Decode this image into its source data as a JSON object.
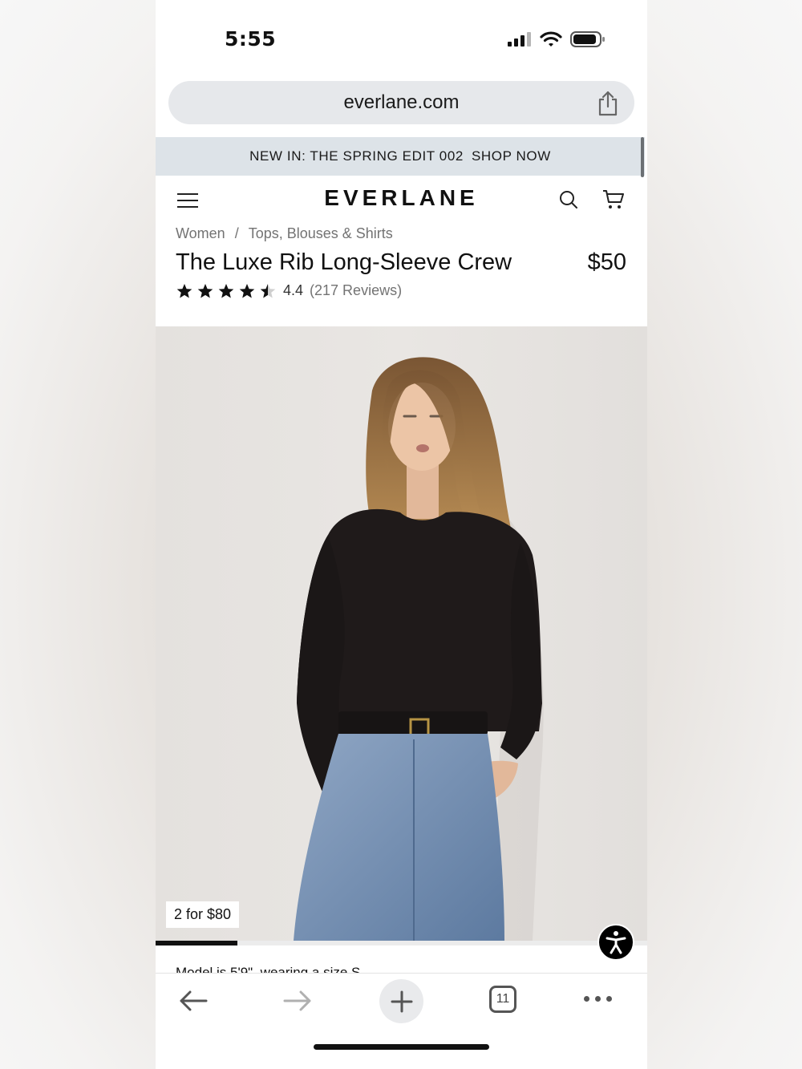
{
  "status_bar": {
    "time": "5:55"
  },
  "browser": {
    "url": "everlane.com",
    "open_tabs": "11"
  },
  "promo": {
    "text": "NEW IN: THE SPRING EDIT 002",
    "cta": "SHOP NOW"
  },
  "site": {
    "logo": "EVERLANE"
  },
  "breadcrumb": {
    "items": [
      "Women",
      "Tops, Blouses & Shirts"
    ],
    "separator": "/"
  },
  "product": {
    "title": "The Luxe Rib Long-Sleeve Crew",
    "price": "$50",
    "rating": 4.4,
    "rating_text": "4.4",
    "reviews": "(217 Reviews)",
    "deal_badge": "2 for $80",
    "image_progress": 0.166,
    "model_note": "Model is 5'9\", wearing a size S"
  },
  "colors": {
    "promo_bg": "#dde3e8",
    "url_bar_bg": "#e6e8eb",
    "text": "#111111",
    "muted": "#737373"
  },
  "icons": [
    "menu-icon",
    "search-icon",
    "cart-icon",
    "share-icon",
    "star-icon",
    "accessibility-icon",
    "back-arrow-icon",
    "forward-arrow-icon",
    "plus-icon",
    "tabs-icon",
    "more-icon"
  ]
}
